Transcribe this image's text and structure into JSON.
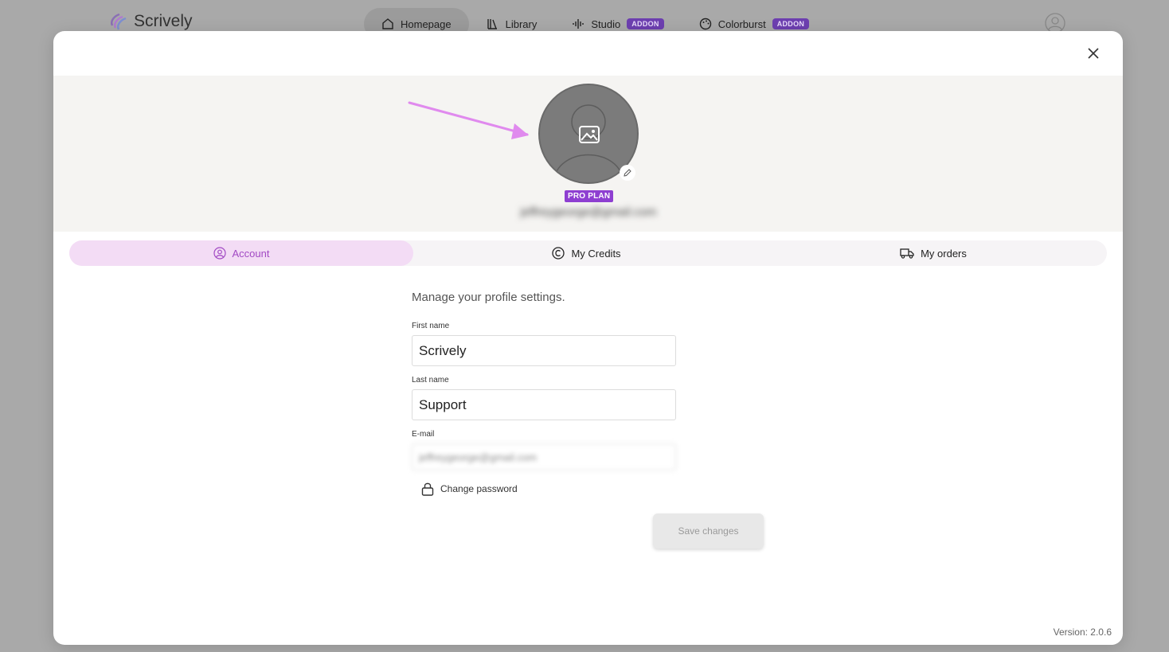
{
  "topnav": {
    "brand": "Scrively",
    "items": [
      {
        "label": "Homepage",
        "icon": "home-icon",
        "active": true
      },
      {
        "label": "Library",
        "icon": "library-icon",
        "active": false
      },
      {
        "label": "Studio",
        "icon": "audio-wave-icon",
        "badge": "ADDON",
        "active": false
      },
      {
        "label": "Colorburst",
        "icon": "palette-icon",
        "badge": "ADDON",
        "active": false
      }
    ]
  },
  "profile": {
    "plan": "PRO PLAN",
    "email": "jeffreygeorge@gmail.com"
  },
  "tabs": [
    {
      "label": "Account",
      "icon": "user-circle-icon",
      "active": true
    },
    {
      "label": "My Credits",
      "icon": "coin-icon",
      "active": false
    },
    {
      "label": "My orders",
      "icon": "truck-icon",
      "active": false
    }
  ],
  "form": {
    "heading": "Manage your profile settings.",
    "first_name_label": "First name",
    "first_name": "Scrively",
    "last_name_label": "Last name",
    "last_name": "Support",
    "email_label": "E-mail",
    "email": "jeffreygeorge@gmail.com",
    "change_password": "Change password",
    "save_label": "Save changes"
  },
  "version": "Version: 2.0.6",
  "colors": {
    "accent": "#a24ac4",
    "plan_badge": "#8e3fd1",
    "addon_badge": "#6d3fb0",
    "annotation_arrow": "#e08aee"
  }
}
